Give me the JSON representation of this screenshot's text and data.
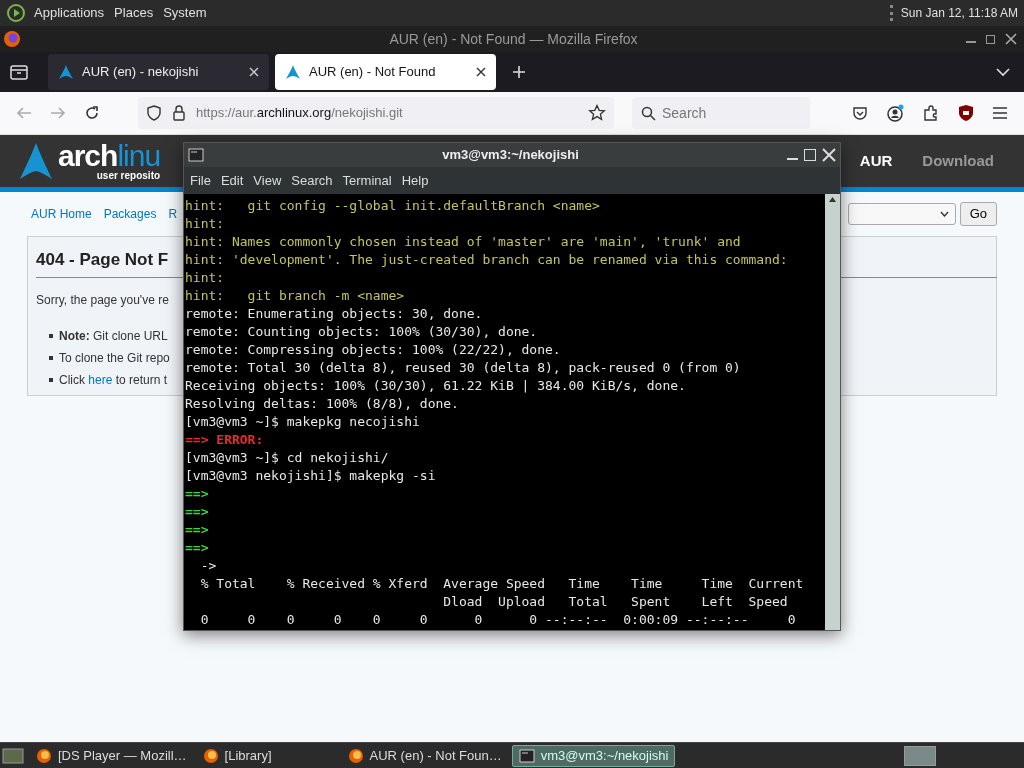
{
  "top_panel": {
    "menus": [
      "Applications",
      "Places",
      "System"
    ],
    "clock": "Sun Jan 12, 11:18 AM"
  },
  "firefox": {
    "title": "AUR (en) - Not Found — Mozilla Firefox",
    "tabs": [
      {
        "label": "AUR (en) - nekojishi",
        "selected": false
      },
      {
        "label": "AUR (en) - Not Found",
        "selected": true
      }
    ],
    "url": {
      "prefix": "https://aur.",
      "domain": "archlinux.org",
      "path": "/nekojishi.git"
    },
    "search": {
      "placeholder": "Search"
    }
  },
  "page": {
    "logo": {
      "bold": "arch",
      "light": "linu",
      "subtitle": "user reposito"
    },
    "header_links": [
      {
        "label": "AUR",
        "selected": true
      },
      {
        "label": "Download",
        "selected": false
      }
    ],
    "nav_links": [
      "AUR Home",
      "Packages",
      "R"
    ],
    "go_button": "Go",
    "panel": {
      "title": "404 - Page Not F",
      "text": "Sorry, the page you've re",
      "bullets": [
        [
          {
            "text": "**Note:** Git clone URL",
            "link": false
          }
        ],
        [
          {
            "text": "To clone the Git repo",
            "link": false
          }
        ],
        [
          {
            "text": "Click",
            "link": false
          },
          {
            "text": "here",
            "link": true
          },
          {
            "text": "to return t",
            "link": false
          }
        ]
      ]
    }
  },
  "terminal": {
    "title": "vm3@vm3:~/nekojishi",
    "menu": [
      "File",
      "Edit",
      "View",
      "Search",
      "Terminal",
      "Help"
    ],
    "lines": [
      {
        "kind": "hint",
        "text": "hint:   git config --global init.defaultBranch <name>"
      },
      {
        "kind": "hint",
        "text": "hint:"
      },
      {
        "kind": "hint",
        "text": "hint: Names commonly chosen instead of 'master' are 'main', 'trunk' and"
      },
      {
        "kind": "hint",
        "text": "hint: 'development'. The just-created branch can be renamed via this command:"
      },
      {
        "kind": "hint",
        "text": "hint:"
      },
      {
        "kind": "hint",
        "text": "hint:   git branch -m <name>"
      },
      {
        "kind": "plain",
        "text": "remote: Enumerating objects: 30, done."
      },
      {
        "kind": "plain",
        "text": "remote: Counting objects: 100% (30/30), done."
      },
      {
        "kind": "plain",
        "text": "remote: Compressing objects: 100% (22/22), done."
      },
      {
        "kind": "plain",
        "text": "remote: Total 30 (delta 8), reused 30 (delta 8), pack-reused 0 (from 0)"
      },
      {
        "kind": "plain",
        "text": "Receiving objects: 100% (30/30), 61.22 KiB | 384.00 KiB/s, done."
      },
      {
        "kind": "plain",
        "text": "Resolving deltas: 100% (8/8), done."
      },
      {
        "kind": "plain",
        "text": "[vm3@vm3 ~]$ makepkg necojishi"
      },
      {
        "kind": "error",
        "text": "==> ERROR:"
      },
      {
        "kind": "plain",
        "text": "[vm3@vm3 ~]$ cd nekojishi/"
      },
      {
        "kind": "plain",
        "text": "[vm3@vm3 nekojishi]$ makepkg -si"
      },
      {
        "kind": "arrow",
        "text": "==>"
      },
      {
        "kind": "arrow",
        "text": "==>"
      },
      {
        "kind": "arrow",
        "text": "==>"
      },
      {
        "kind": "arrow",
        "text": "==>"
      },
      {
        "kind": "plain",
        "text": "  ->"
      },
      {
        "kind": "plain",
        "text": "  % Total    % Received % Xferd  Average Speed   Time    Time     Time  Current"
      },
      {
        "kind": "plain",
        "text": "                                 Dload  Upload   Total   Spent    Left  Speed"
      },
      {
        "kind": "plain",
        "text": "  0     0    0     0    0     0      0      0 --:--:--  0:00:09 --:--:--     0"
      }
    ]
  },
  "taskbar": {
    "items": [
      {
        "label": "[DS Player — Mozill…",
        "kind": "firefox",
        "selected": false
      },
      {
        "label": "[Library]",
        "kind": "firefox",
        "selected": false
      },
      {
        "label": "AUR (en) - Not Foun…",
        "kind": "firefox",
        "selected": false
      },
      {
        "label": "vm3@vm3:~/nekojishi",
        "kind": "terminal",
        "selected": true
      }
    ]
  }
}
